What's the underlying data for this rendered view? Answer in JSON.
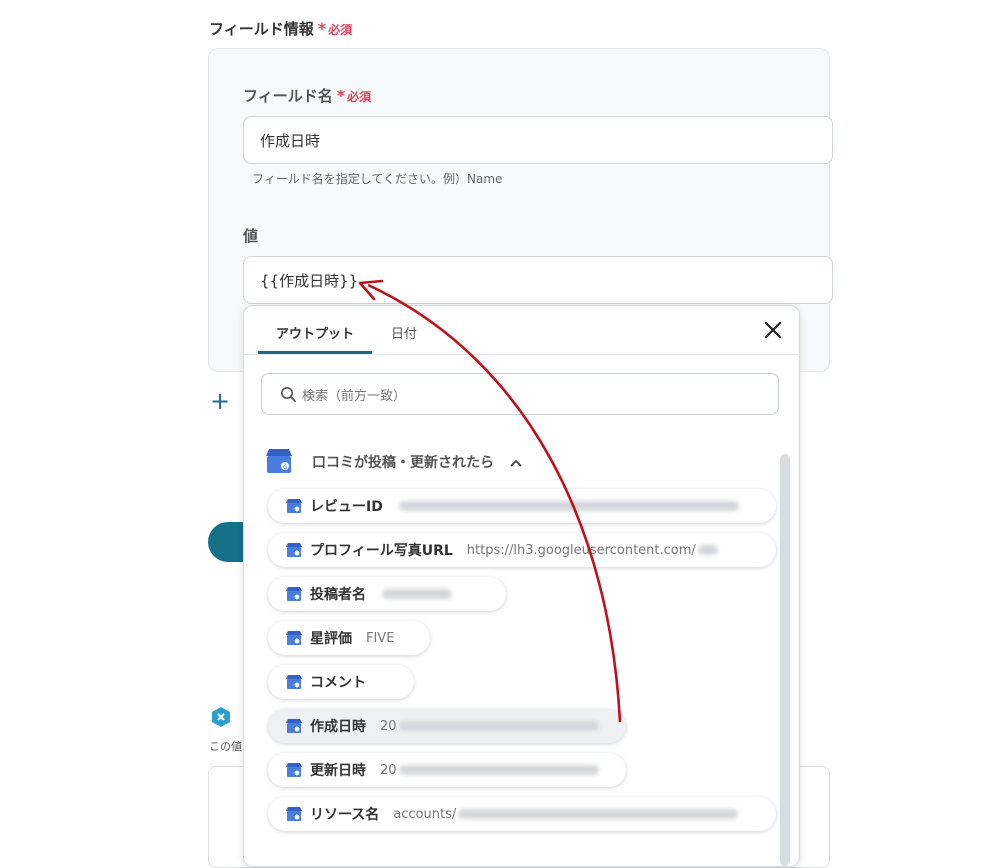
{
  "section": {
    "title": "フィールド情報",
    "required": "必須"
  },
  "field_name": {
    "label": "フィールド名",
    "required": "必須",
    "value": "作成日時",
    "hint": "フィールド名を指定してください。例）Name"
  },
  "value_field": {
    "label": "値",
    "value": "{{作成日時}}"
  },
  "add_icon": "+",
  "below": {
    "text": "この値"
  },
  "panel": {
    "tabs": [
      {
        "label": "アウトプット"
      },
      {
        "label": "日付"
      }
    ],
    "close": "×",
    "search_placeholder": "検索（前方一致）",
    "group": {
      "title": "口コミが投稿・更新されたら",
      "icon": "google-my-business-icon"
    },
    "items": [
      {
        "name": "レビューID",
        "value": ""
      },
      {
        "name": "プロフィール写真URL",
        "value": "https://lh3.googleusercontent.com/"
      },
      {
        "name": "投稿者名",
        "value": ""
      },
      {
        "name": "星評価",
        "value": "FIVE"
      },
      {
        "name": "コメント",
        "value": ""
      },
      {
        "name": "作成日時",
        "value": "20"
      },
      {
        "name": "更新日時",
        "value": "20"
      },
      {
        "name": "リソース名",
        "value": "accounts/"
      }
    ]
  },
  "colors": {
    "accent": "#16708a",
    "required": "#e0445b",
    "arrow": "#c0101c"
  }
}
